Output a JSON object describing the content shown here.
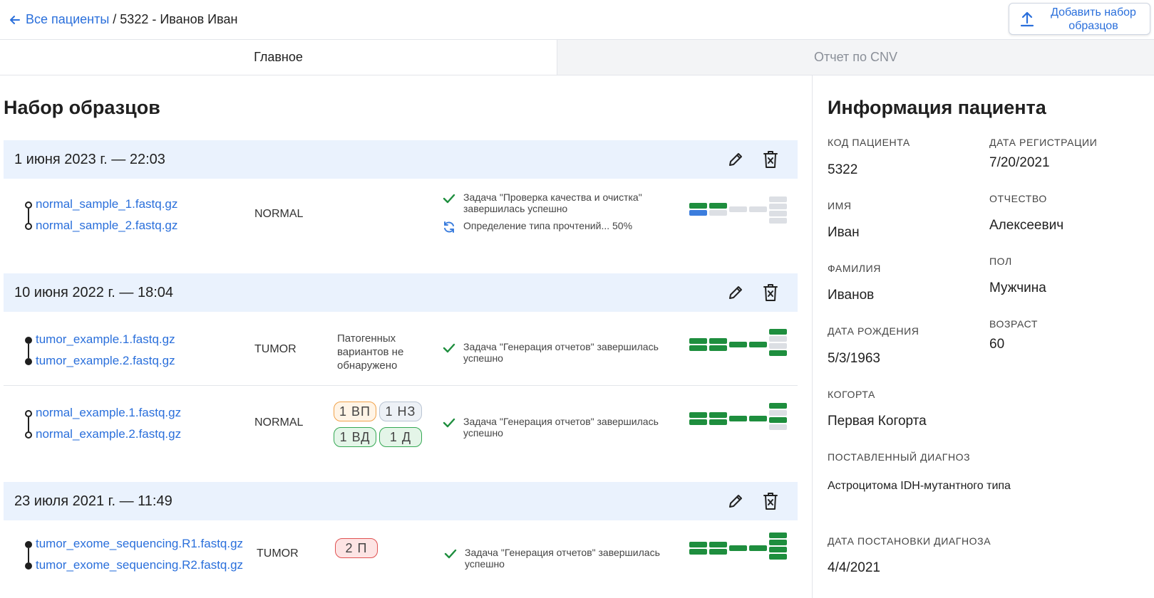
{
  "header": {
    "back_label": "Все пациенты",
    "separator": "/",
    "current": "5322 - Иванов Иван",
    "add_button_label": "Добавить набор образцов"
  },
  "tabs": [
    {
      "label": "Главное",
      "active": true
    },
    {
      "label": "Отчет по CNV",
      "active": false
    }
  ],
  "samples": {
    "title": "Набор образцов",
    "groups": [
      {
        "date": "1 июня 2023 г. — 22:03",
        "rows": [
          {
            "files": [
              "normal_sample_1.fastq.gz",
              "normal_sample_2.fastq.gz"
            ],
            "type": "NORMAL",
            "statuses": [
              {
                "icon": "check-icon",
                "text": "Задача \"Проверка качества и очистка\" завершилась успешно"
              },
              {
                "icon": "sync-icon",
                "text": "Определение типа прочтений... 50%"
              }
            ]
          }
        ]
      },
      {
        "date": "10 июня 2022 г. — 18:04",
        "rows": [
          {
            "files": [
              "tumor_example.1.fastq.gz",
              "tumor_example.2.fastq.gz"
            ],
            "type": "TUMOR",
            "variants_text": "Патогенных вариантов не обнаружено",
            "statuses": [
              {
                "icon": "check-icon",
                "text": "Задача \"Генерация отчетов\" завершилась успешно"
              }
            ]
          },
          {
            "files": [
              "normal_example.1.fastq.gz",
              "normal_example.2.fastq.gz"
            ],
            "type": "NORMAL",
            "badges": [
              "1 ВП",
              "1 НЗ",
              "1 ВД",
              "1 Д"
            ],
            "statuses": [
              {
                "icon": "check-icon",
                "text": "Задача \"Генерация отчетов\" завершилась успешно"
              }
            ]
          }
        ]
      },
      {
        "date": "23 июля 2021 г. — 11:49",
        "rows": [
          {
            "files": [
              "tumor_exome_sequencing.R1.fastq.gz",
              "tumor_exome_sequencing.R2.fastq.gz"
            ],
            "type": "TUMOR",
            "badges": [
              "2 П"
            ],
            "statuses": [
              {
                "icon": "check-icon",
                "text": "Задача \"Генерация отчетов\" завершилась успешно"
              }
            ]
          }
        ]
      }
    ]
  },
  "patient": {
    "title": "Информация пациента",
    "fields": {
      "code": {
        "label": "КОД ПАЦИЕНТА",
        "value": "5322"
      },
      "registration_date": {
        "label": "ДАТА РЕГИСТРАЦИИ",
        "value": "7/20/2021"
      },
      "first_name": {
        "label": "ИМЯ",
        "value": "Иван"
      },
      "patronymic": {
        "label": "ОТЧЕСТВО",
        "value": "Алексеевич"
      },
      "last_name": {
        "label": "ФАМИЛИЯ",
        "value": "Иванов"
      },
      "sex": {
        "label": "ПОЛ",
        "value": "Мужчина"
      },
      "birth_date": {
        "label": "ДАТА РОЖДЕНИЯ",
        "value": "5/3/1963"
      },
      "age": {
        "label": "ВОЗРАСТ",
        "value": "60"
      },
      "cohort": {
        "label": "КОГОРТА",
        "value": "Первая Когорта"
      },
      "diagnosis": {
        "label": "ПОСТАВЛЕННЫЙ ДИАГНОЗ",
        "value": "Астроцитома IDH-мутантного типа"
      },
      "diagnosis_date": {
        "label": "ДАТА ПОСТАНОВКИ ДИАГНОЗА",
        "value": "4/4/2021"
      }
    }
  },
  "colors": {
    "accent": "#2a6fdb",
    "success": "#1e8e3e",
    "in_progress": "#3b7ddd",
    "pending": "#dcdfe4",
    "group_header_bg": "#eaf2fd"
  }
}
